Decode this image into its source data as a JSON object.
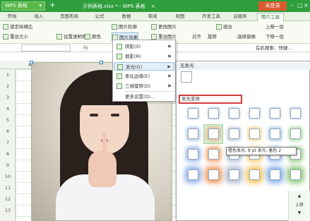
{
  "titlebar": {
    "app_name": "WPS 表格",
    "new_tab_icon": "+",
    "doc_title": "示例表格.xlsx * - WPS 表格",
    "doc_close": "×",
    "login": "未登录",
    "controls": [
      "–",
      "□",
      "×"
    ]
  },
  "menu_tabs": [
    "开始",
    "插入",
    "页面布局",
    "公式",
    "数据",
    "审阅",
    "视图",
    "开发工具",
    "云服务",
    "图片工具"
  ],
  "ribbon": {
    "lock_ratio": "锁定纵横比",
    "reset_size": "重设大小",
    "transparent_color": "设置透明色",
    "color": "颜色",
    "contour": "图片轮廓",
    "effect": "图片效果",
    "change_image": "更改图片",
    "reset_image": "重设图片",
    "align": "对齐",
    "rotate": "旋转",
    "combine": "组合",
    "select_pane": "选择窗格",
    "up_layer": "上移一层",
    "down_layer": "下移一层",
    "select_object": "选择对象"
  },
  "formula_bar": {
    "fx": "fx",
    "right_text": "在此搜索、快捷..."
  },
  "columns": [
    "A",
    "B",
    "C",
    "D",
    "E",
    "F",
    "G",
    "H",
    "I"
  ],
  "rows": [
    "1",
    "2",
    "3",
    "4",
    "5",
    "6",
    "7",
    "8",
    "9",
    "10",
    "11",
    "12",
    "13"
  ],
  "effect_menu": [
    {
      "label": "阴影(S)",
      "arrow": "▶"
    },
    {
      "label": "倒影(R)",
      "arrow": "▶"
    },
    {
      "label": "发光(G)",
      "arrow": "▶"
    },
    {
      "label": "柔化边缘(E)",
      "arrow": "▶"
    },
    {
      "label": "三维旋转(D)",
      "arrow": "▶"
    },
    {
      "label": "更多设置(O)...",
      "arrow": ""
    }
  ],
  "glow_panel": {
    "no_glow": "无发光",
    "variants": "发光变体",
    "tooltip": "橙色发光, 8 pt 发光, 着色 2"
  },
  "right_tools": [
    "▲",
    "上移",
    "▼"
  ]
}
